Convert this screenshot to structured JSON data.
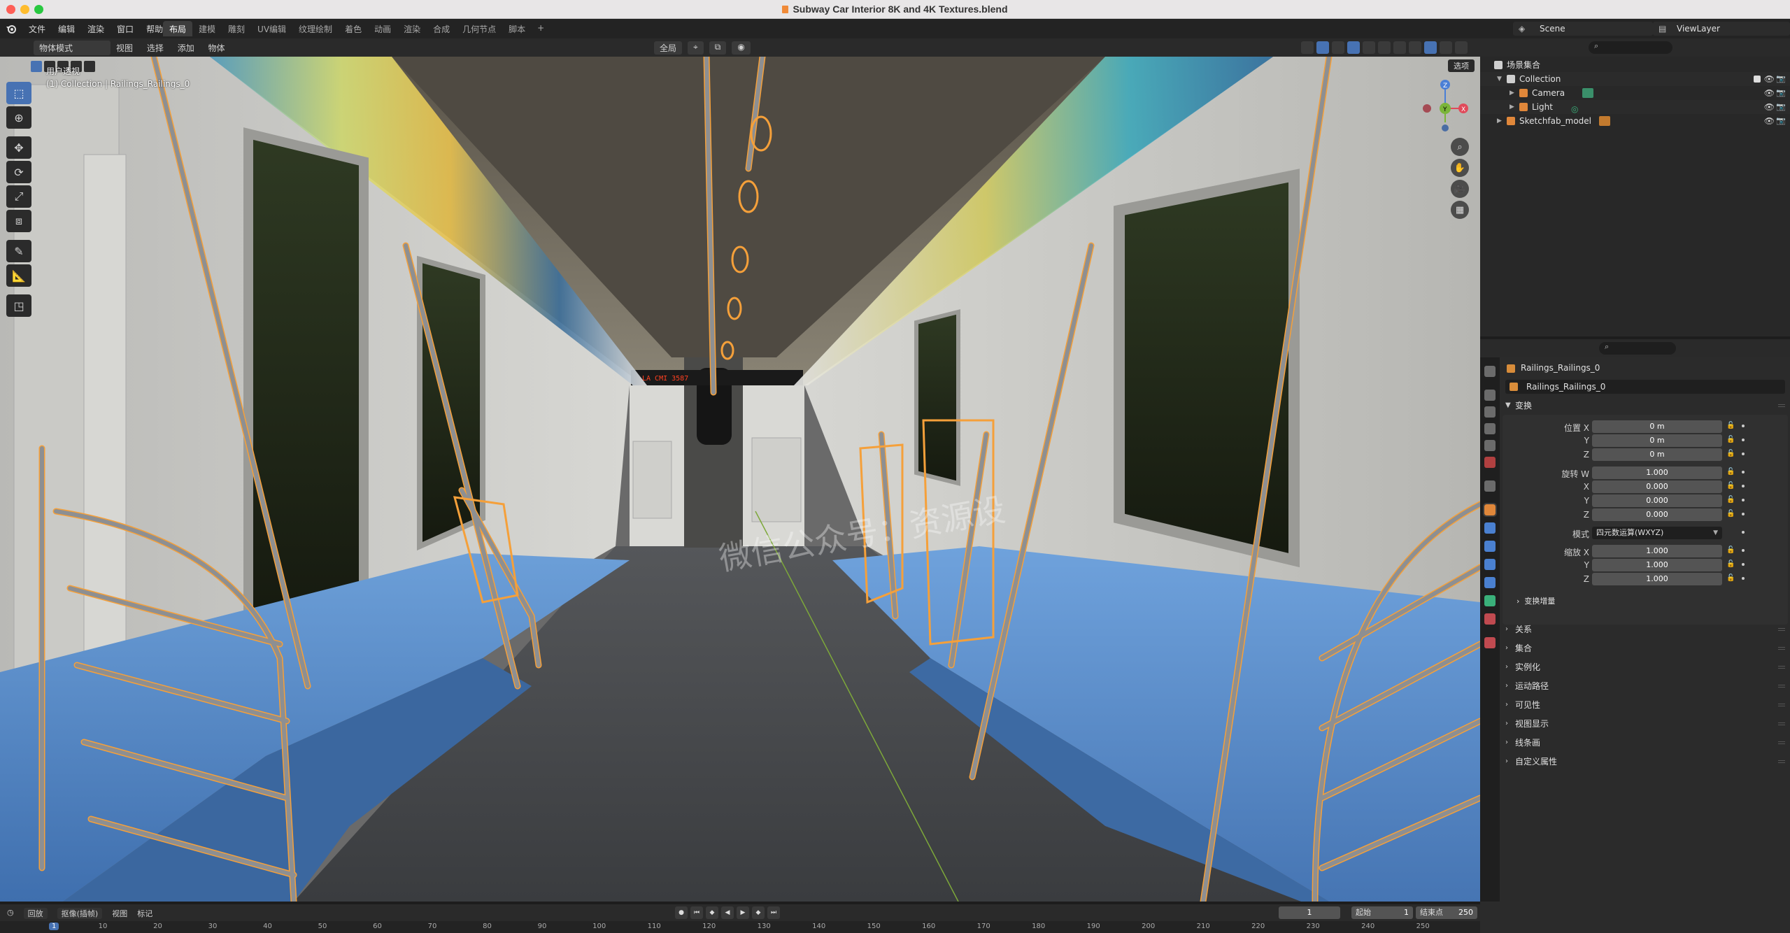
{
  "window": {
    "title": "Subway Car Interior 8K and 4K Textures.blend"
  },
  "menu": [
    "文件",
    "编辑",
    "渲染",
    "窗口",
    "帮助"
  ],
  "workspaces": [
    {
      "label": "布局",
      "active": true
    },
    {
      "label": "建模"
    },
    {
      "label": "雕刻"
    },
    {
      "label": "UV编辑"
    },
    {
      "label": "纹理绘制"
    },
    {
      "label": "着色"
    },
    {
      "label": "动画"
    },
    {
      "label": "渲染"
    },
    {
      "label": "合成"
    },
    {
      "label": "几何节点"
    },
    {
      "label": "脚本"
    }
  ],
  "workspace_add": "+",
  "scene": {
    "label": "Scene",
    "icon": "scene-icon"
  },
  "view_layer": {
    "label": "ViewLayer",
    "icon": "view-layer-icon"
  },
  "viewport_header": {
    "mode": "物体模式",
    "menus": [
      "视图",
      "选择",
      "添加",
      "物体"
    ],
    "transform_orientation": "全局"
  },
  "viewport": {
    "view_name": "用户透视",
    "context": "(1) Collection | Railings_Railings_0",
    "options_label": "选项",
    "watermark": "微信公众号：资源设",
    "sign_text": "LA CMI 3587"
  },
  "outliner": {
    "root": "场景集合",
    "items": [
      {
        "name": "Collection",
        "type": "collection",
        "depth": 1,
        "expanded": true,
        "checked": true
      },
      {
        "name": "Camera",
        "type": "camera",
        "depth": 2
      },
      {
        "name": "Light",
        "type": "light",
        "depth": 2
      },
      {
        "name": "Sketchfab_model",
        "type": "empty",
        "depth": 1
      }
    ]
  },
  "properties": {
    "object_name": "Railings_Railings_0",
    "object_field": "Railings_Railings_0",
    "transform_title": "变换",
    "location": {
      "label": "位置 X",
      "x": "0 m",
      "y": "0 m",
      "z": "0 m"
    },
    "rotation": {
      "label": "旋转 W",
      "w": "1.000",
      "x": "0.000",
      "y": "0.000",
      "z": "0.000"
    },
    "mode": {
      "label": "模式",
      "value": "四元数运算(WXYZ)"
    },
    "scale": {
      "label": "缩放 X",
      "x": "1.000",
      "y": "1.000",
      "z": "1.000"
    },
    "axis_labels": {
      "y": "Y",
      "z": "Z",
      "x": "X"
    },
    "delta_transform": "变换增量",
    "panels": [
      "关系",
      "集合",
      "实例化",
      "运动路径",
      "可见性",
      "视图显示",
      "线条画",
      "自定义属性"
    ]
  },
  "timeline": {
    "menus": [
      "回放",
      "抠像(插帧)",
      "视图",
      "标记"
    ],
    "current_frame": "1",
    "start_label": "起始",
    "start_value": "1",
    "end_label": "结束点",
    "end_value": "250",
    "ticks": [
      "1",
      "10",
      "20",
      "30",
      "40",
      "50",
      "60",
      "70",
      "80",
      "90",
      "100",
      "110",
      "120",
      "130",
      "140",
      "150",
      "160",
      "170",
      "180",
      "190",
      "200",
      "210",
      "220",
      "230",
      "240",
      "250"
    ]
  },
  "colors": {
    "accent": "#4772b3",
    "selection_outline": "#f5a03a",
    "seat_blue": "#5b8fd0"
  }
}
